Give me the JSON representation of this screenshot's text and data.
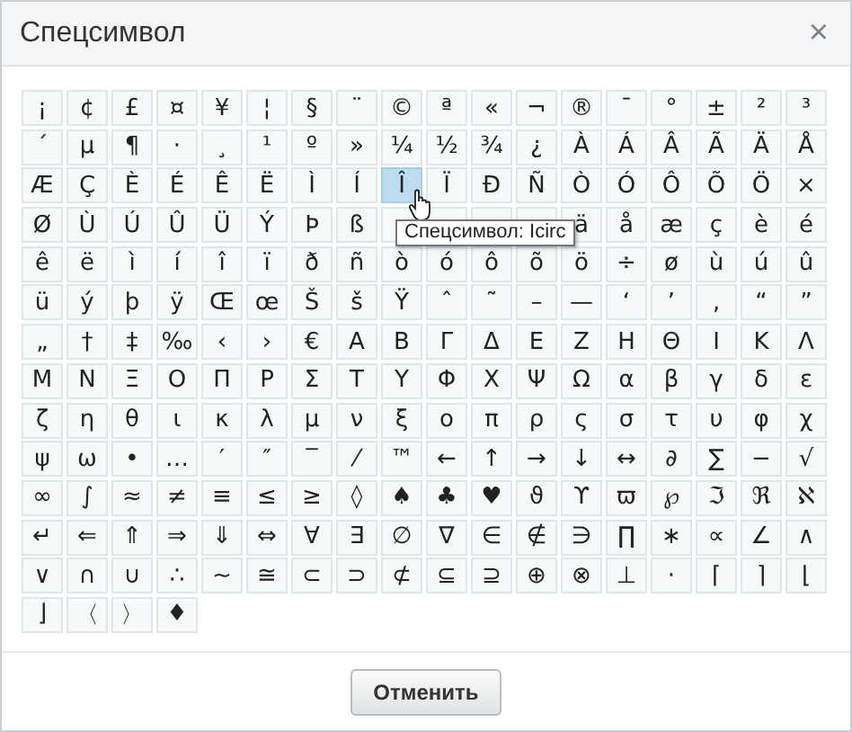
{
  "dialog": {
    "title": "Спецсимвол",
    "close": "×"
  },
  "rows": [
    {
      "cells": [
        {
          "c": "¡",
          "selected": false
        },
        {
          "c": "¢",
          "selected": false
        },
        {
          "c": "£",
          "selected": false
        },
        {
          "c": "¤",
          "selected": false
        },
        {
          "c": "¥",
          "selected": false
        },
        {
          "c": "¦",
          "selected": false
        },
        {
          "c": "§",
          "selected": false
        },
        {
          "c": "¨",
          "selected": false
        },
        {
          "c": "©",
          "selected": false
        },
        {
          "c": "ª",
          "selected": false
        },
        {
          "c": "«",
          "selected": false
        },
        {
          "c": "¬",
          "selected": false
        },
        {
          "c": "®",
          "selected": false
        },
        {
          "c": "¯",
          "selected": false
        },
        {
          "c": "°",
          "selected": false
        },
        {
          "c": "±",
          "selected": false
        },
        {
          "c": "²",
          "selected": false
        },
        {
          "c": "³",
          "selected": false
        }
      ]
    },
    {
      "cells": [
        {
          "c": "´",
          "selected": false
        },
        {
          "c": "µ",
          "selected": false
        },
        {
          "c": "¶",
          "selected": false
        },
        {
          "c": "·",
          "selected": false
        },
        {
          "c": "¸",
          "selected": false
        },
        {
          "c": "¹",
          "selected": false
        },
        {
          "c": "º",
          "selected": false
        },
        {
          "c": "»",
          "selected": false
        },
        {
          "c": "¼",
          "selected": false
        },
        {
          "c": "½",
          "selected": false
        },
        {
          "c": "¾",
          "selected": false
        },
        {
          "c": "¿",
          "selected": false
        },
        {
          "c": "À",
          "selected": false
        },
        {
          "c": "Á",
          "selected": false
        },
        {
          "c": "Â",
          "selected": false
        },
        {
          "c": "Ã",
          "selected": false
        },
        {
          "c": "Ä",
          "selected": false
        },
        {
          "c": "Å",
          "selected": false
        }
      ]
    },
    {
      "cells": [
        {
          "c": "Æ",
          "selected": false
        },
        {
          "c": "Ç",
          "selected": false
        },
        {
          "c": "È",
          "selected": false
        },
        {
          "c": "É",
          "selected": false
        },
        {
          "c": "Ê",
          "selected": false
        },
        {
          "c": "Ë",
          "selected": false
        },
        {
          "c": "Ì",
          "selected": false
        },
        {
          "c": "Í",
          "selected": false
        },
        {
          "c": "Î",
          "selected": true
        },
        {
          "c": "Ï",
          "selected": false
        },
        {
          "c": "Ð",
          "selected": false
        },
        {
          "c": "Ñ",
          "selected": false
        },
        {
          "c": "Ò",
          "selected": false
        },
        {
          "c": "Ó",
          "selected": false
        },
        {
          "c": "Ô",
          "selected": false
        },
        {
          "c": "Õ",
          "selected": false
        },
        {
          "c": "Ö",
          "selected": false
        },
        {
          "c": "×",
          "selected": false
        }
      ]
    },
    {
      "cells": [
        {
          "c": "Ø",
          "selected": false
        },
        {
          "c": "Ù",
          "selected": false
        },
        {
          "c": "Ú",
          "selected": false
        },
        {
          "c": "Û",
          "selected": false
        },
        {
          "c": "Ü",
          "selected": false
        },
        {
          "c": "Ý",
          "selected": false
        },
        {
          "c": "Þ",
          "selected": false
        },
        {
          "c": "ß",
          "selected": false
        },
        {
          "selected": false
        },
        {
          "selected": false
        },
        {
          "selected": false
        },
        {
          "selected": false
        },
        {
          "c": "ä",
          "selected": false
        },
        {
          "c": "å",
          "selected": false
        },
        {
          "c": "æ",
          "selected": false
        },
        {
          "c": "ç",
          "selected": false
        },
        {
          "c": "è",
          "selected": false
        },
        {
          "c": "é",
          "selected": false
        }
      ]
    },
    {
      "cells": [
        {
          "c": "ê",
          "selected": false
        },
        {
          "c": "ë",
          "selected": false
        },
        {
          "c": "ì",
          "selected": false
        },
        {
          "c": "í",
          "selected": false
        },
        {
          "c": "î",
          "selected": false
        },
        {
          "c": "ï",
          "selected": false
        },
        {
          "c": "ð",
          "selected": false
        },
        {
          "c": "ñ",
          "selected": false
        },
        {
          "c": "ò",
          "selected": false
        },
        {
          "c": "ó",
          "selected": false
        },
        {
          "c": "ô",
          "selected": false
        },
        {
          "c": "õ",
          "selected": false
        },
        {
          "c": "ö",
          "selected": false
        },
        {
          "c": "÷",
          "selected": false
        },
        {
          "c": "ø",
          "selected": false
        },
        {
          "c": "ù",
          "selected": false
        },
        {
          "c": "ú",
          "selected": false
        },
        {
          "c": "û",
          "selected": false
        }
      ]
    },
    {
      "cells": [
        {
          "c": "ü",
          "selected": false
        },
        {
          "c": "ý",
          "selected": false
        },
        {
          "c": "þ",
          "selected": false
        },
        {
          "c": "ÿ",
          "selected": false
        },
        {
          "c": "Œ",
          "selected": false
        },
        {
          "c": "œ",
          "selected": false
        },
        {
          "c": "Š",
          "selected": false
        },
        {
          "c": "š",
          "selected": false
        },
        {
          "c": "Ÿ",
          "selected": false
        },
        {
          "c": "ˆ",
          "selected": false
        },
        {
          "c": "˜",
          "selected": false
        },
        {
          "c": "–",
          "selected": false
        },
        {
          "c": "—",
          "selected": false
        },
        {
          "c": "‘",
          "selected": false
        },
        {
          "c": "’",
          "selected": false
        },
        {
          "c": "‚",
          "selected": false
        },
        {
          "c": "“",
          "selected": false
        },
        {
          "c": "”",
          "selected": false
        }
      ]
    },
    {
      "cells": [
        {
          "c": "„",
          "selected": false
        },
        {
          "c": "†",
          "selected": false
        },
        {
          "c": "‡",
          "selected": false
        },
        {
          "c": "‰",
          "selected": false
        },
        {
          "c": "‹",
          "selected": false
        },
        {
          "c": "›",
          "selected": false
        },
        {
          "c": "€",
          "selected": false
        },
        {
          "c": "Α",
          "selected": false
        },
        {
          "c": "Β",
          "selected": false
        },
        {
          "c": "Γ",
          "selected": false
        },
        {
          "c": "Δ",
          "selected": false
        },
        {
          "c": "Ε",
          "selected": false
        },
        {
          "c": "Ζ",
          "selected": false
        },
        {
          "c": "Η",
          "selected": false
        },
        {
          "c": "Θ",
          "selected": false
        },
        {
          "c": "Ι",
          "selected": false
        },
        {
          "c": "Κ",
          "selected": false
        },
        {
          "c": "Λ",
          "selected": false
        }
      ]
    },
    {
      "cells": [
        {
          "c": "Μ",
          "selected": false
        },
        {
          "c": "Ν",
          "selected": false
        },
        {
          "c": "Ξ",
          "selected": false
        },
        {
          "c": "Ο",
          "selected": false
        },
        {
          "c": "Π",
          "selected": false
        },
        {
          "c": "Ρ",
          "selected": false
        },
        {
          "c": "Σ",
          "selected": false
        },
        {
          "c": "Τ",
          "selected": false
        },
        {
          "c": "Υ",
          "selected": false
        },
        {
          "c": "Φ",
          "selected": false
        },
        {
          "c": "Χ",
          "selected": false
        },
        {
          "c": "Ψ",
          "selected": false
        },
        {
          "c": "Ω",
          "selected": false
        },
        {
          "c": "α",
          "selected": false
        },
        {
          "c": "β",
          "selected": false
        },
        {
          "c": "γ",
          "selected": false
        },
        {
          "c": "δ",
          "selected": false
        },
        {
          "c": "ε",
          "selected": false
        }
      ]
    },
    {
      "cells": [
        {
          "c": "ζ",
          "selected": false
        },
        {
          "c": "η",
          "selected": false
        },
        {
          "c": "θ",
          "selected": false
        },
        {
          "c": "ι",
          "selected": false
        },
        {
          "c": "κ",
          "selected": false
        },
        {
          "c": "λ",
          "selected": false
        },
        {
          "c": "μ",
          "selected": false
        },
        {
          "c": "ν",
          "selected": false
        },
        {
          "c": "ξ",
          "selected": false
        },
        {
          "c": "ο",
          "selected": false
        },
        {
          "c": "π",
          "selected": false
        },
        {
          "c": "ρ",
          "selected": false
        },
        {
          "c": "ς",
          "selected": false
        },
        {
          "c": "σ",
          "selected": false
        },
        {
          "c": "τ",
          "selected": false
        },
        {
          "c": "υ",
          "selected": false
        },
        {
          "c": "φ",
          "selected": false
        },
        {
          "c": "χ",
          "selected": false
        }
      ]
    },
    {
      "cells": [
        {
          "c": "ψ",
          "selected": false
        },
        {
          "c": "ω",
          "selected": false
        },
        {
          "c": "•",
          "selected": false
        },
        {
          "c": "…",
          "selected": false
        },
        {
          "c": "′",
          "selected": false
        },
        {
          "c": "″",
          "selected": false
        },
        {
          "c": "‾",
          "selected": false
        },
        {
          "c": "⁄",
          "selected": false
        },
        {
          "c": "™",
          "selected": false
        },
        {
          "c": "←",
          "selected": false
        },
        {
          "c": "↑",
          "selected": false
        },
        {
          "c": "→",
          "selected": false
        },
        {
          "c": "↓",
          "selected": false
        },
        {
          "c": "↔",
          "selected": false
        },
        {
          "c": "∂",
          "selected": false
        },
        {
          "c": "∑",
          "selected": false
        },
        {
          "c": "−",
          "selected": false
        },
        {
          "c": "√",
          "selected": false
        }
      ]
    },
    {
      "cells": [
        {
          "c": "∞",
          "selected": false
        },
        {
          "c": "∫",
          "selected": false
        },
        {
          "c": "≈",
          "selected": false
        },
        {
          "c": "≠",
          "selected": false
        },
        {
          "c": "≡",
          "selected": false
        },
        {
          "c": "≤",
          "selected": false
        },
        {
          "c": "≥",
          "selected": false
        },
        {
          "c": "◊",
          "selected": false
        },
        {
          "c": "♠",
          "selected": false
        },
        {
          "c": "♣",
          "selected": false
        },
        {
          "c": "♥",
          "selected": false
        },
        {
          "c": "ϑ",
          "selected": false
        },
        {
          "c": "ϒ",
          "selected": false
        },
        {
          "c": "ϖ",
          "selected": false
        },
        {
          "c": "℘",
          "selected": false
        },
        {
          "c": "ℑ",
          "selected": false
        },
        {
          "c": "ℜ",
          "selected": false
        },
        {
          "c": "ℵ",
          "selected": false
        }
      ]
    },
    {
      "cells": [
        {
          "c": "↵",
          "selected": false
        },
        {
          "c": "⇐",
          "selected": false
        },
        {
          "c": "⇑",
          "selected": false
        },
        {
          "c": "⇒",
          "selected": false
        },
        {
          "c": "⇓",
          "selected": false
        },
        {
          "c": "⇔",
          "selected": false
        },
        {
          "c": "∀",
          "selected": false
        },
        {
          "c": "∃",
          "selected": false
        },
        {
          "c": "∅",
          "selected": false
        },
        {
          "c": "∇",
          "selected": false
        },
        {
          "c": "∈",
          "selected": false
        },
        {
          "c": "∉",
          "selected": false
        },
        {
          "c": "∋",
          "selected": false
        },
        {
          "c": "∏",
          "selected": false
        },
        {
          "c": "∗",
          "selected": false
        },
        {
          "c": "∝",
          "selected": false
        },
        {
          "c": "∠",
          "selected": false
        },
        {
          "c": "∧",
          "selected": false
        }
      ]
    },
    {
      "cells": [
        {
          "c": "∨",
          "selected": false
        },
        {
          "c": "∩",
          "selected": false
        },
        {
          "c": "∪",
          "selected": false
        },
        {
          "c": "∴",
          "selected": false
        },
        {
          "c": "∼",
          "selected": false
        },
        {
          "c": "≅",
          "selected": false
        },
        {
          "c": "⊂",
          "selected": false
        },
        {
          "c": "⊃",
          "selected": false
        },
        {
          "c": "⊄",
          "selected": false
        },
        {
          "c": "⊆",
          "selected": false
        },
        {
          "c": "⊇",
          "selected": false
        },
        {
          "c": "⊕",
          "selected": false
        },
        {
          "c": "⊗",
          "selected": false
        },
        {
          "c": "⊥",
          "selected": false
        },
        {
          "c": "⋅",
          "selected": false
        },
        {
          "c": "⌈",
          "selected": false
        },
        {
          "c": "⌉",
          "selected": false
        },
        {
          "c": "⌊",
          "selected": false
        }
      ]
    },
    {
      "cells": [
        {
          "c": "⌋",
          "selected": false
        },
        {
          "c": "〈",
          "selected": false
        },
        {
          "c": "〉",
          "selected": false
        },
        {
          "c": "♦",
          "selected": false
        }
      ]
    }
  ],
  "tooltip": "Спецсимвол: Icirc",
  "buttons": [
    {
      "label": "Отменить"
    }
  ]
}
